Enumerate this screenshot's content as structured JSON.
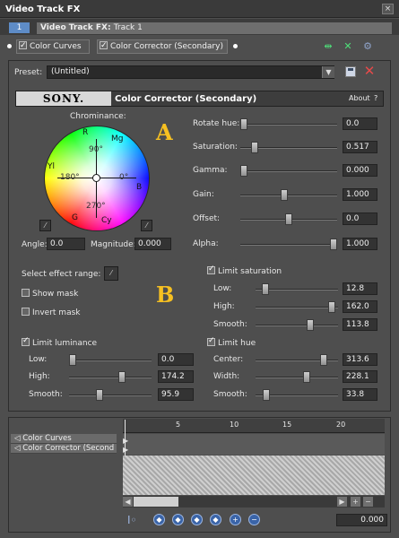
{
  "window": {
    "title": "Video Track FX",
    "close_glyph": "×"
  },
  "track": {
    "number": "1",
    "name": "Video Track FX:",
    "name_sub": "Track 1"
  },
  "chain": {
    "items": [
      {
        "label": "Color Curves",
        "checked": true
      },
      {
        "label": "Color Corrector (Secondary)",
        "checked": true
      }
    ],
    "icons": [
      "plug-in-chain-icon",
      "remove-plugin-icon",
      "plugin-settings-icon"
    ]
  },
  "preset": {
    "label": "Preset:",
    "value": "(Untitled)"
  },
  "header": {
    "brand": "SONY.",
    "effect": "Color Corrector (Secondary)",
    "about": "About",
    "help": "?"
  },
  "chrominance": {
    "title": "Chrominance:",
    "labels": {
      "R": "R",
      "Mg": "Mg",
      "B": "B",
      "Cy": "Cy",
      "G": "G",
      "Yl": "Yl",
      "d90": "90°",
      "d180": "180°",
      "d0": "0°",
      "d270": "270°"
    },
    "angle_label": "Angle:",
    "angle": "0.0",
    "magnitude_label": "Magnitude:",
    "magnitude": "0.000"
  },
  "annotations": {
    "a": "A",
    "b": "B"
  },
  "params": [
    {
      "label": "Rotate hue:",
      "value": "0.0",
      "level": 0.0
    },
    {
      "label": "Saturation:",
      "value": "0.517",
      "level": 0.12
    },
    {
      "label": "Gamma:",
      "value": "0.000",
      "level": 0.0
    },
    {
      "label": "Gain:",
      "value": "1.000",
      "level": 0.45
    },
    {
      "label": "Offset:",
      "value": "0.0",
      "level": 0.5
    },
    {
      "label": "Alpha:",
      "value": "1.000",
      "level": 1.0
    }
  ],
  "range": {
    "select_label": "Select effect range:",
    "show_mask": "Show mask",
    "invert_mask": "Invert mask",
    "limit_saturation": {
      "label": "Limit saturation",
      "checked": true,
      "rows": [
        {
          "label": "Low:",
          "value": "12.8",
          "level": 0.08
        },
        {
          "label": "High:",
          "value": "162.0",
          "level": 0.97
        },
        {
          "label": "Smooth:",
          "value": "113.8",
          "level": 0.68
        }
      ]
    },
    "limit_luminance": {
      "label": "Limit luminance",
      "checked": true,
      "rows": [
        {
          "label": "Low:",
          "value": "0.0",
          "level": 0.0
        },
        {
          "label": "High:",
          "value": "174.2",
          "level": 0.66
        },
        {
          "label": "Smooth:",
          "value": "95.9",
          "level": 0.36
        }
      ]
    },
    "limit_hue": {
      "label": "Limit hue",
      "checked": true,
      "rows": [
        {
          "label": "Center:",
          "value": "313.6",
          "level": 0.86
        },
        {
          "label": "Width:",
          "value": "228.1",
          "level": 0.63
        },
        {
          "label": "Smooth:",
          "value": "33.8",
          "level": 0.09
        }
      ]
    }
  },
  "keyframes": {
    "list": [
      "Color Curves",
      "Color Corrector (Second"
    ],
    "ruler": [
      "5",
      "10",
      "15",
      "20"
    ],
    "time": "0.000",
    "scroll": {
      "plus": "+",
      "minus": "−"
    }
  }
}
